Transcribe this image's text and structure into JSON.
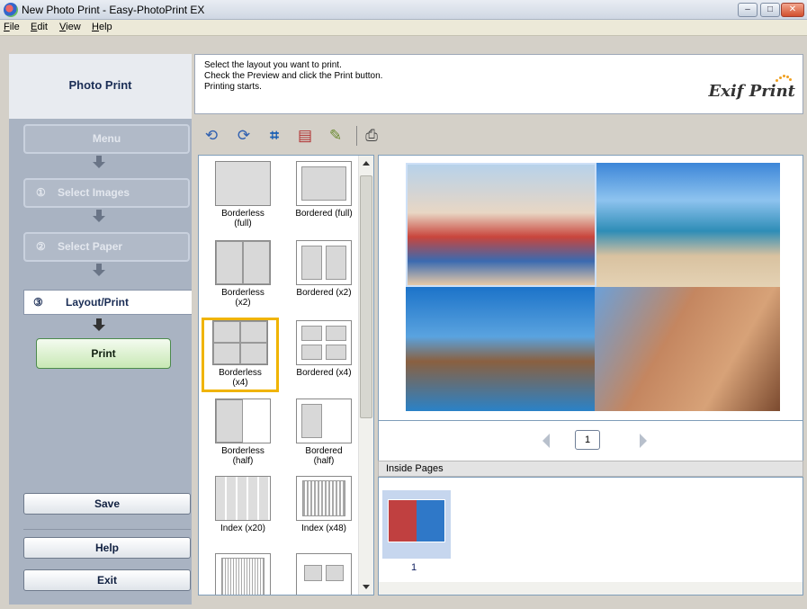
{
  "window": {
    "title": "New Photo Print - Easy-PhotoPrint EX"
  },
  "menu": [
    {
      "underline": "F",
      "rest": "ile"
    },
    {
      "underline": "E",
      "rest": "dit"
    },
    {
      "underline": "V",
      "rest": "iew"
    },
    {
      "underline": "H",
      "rest": "elp"
    }
  ],
  "left": {
    "header": "Photo Print",
    "menu_label": "Menu",
    "steps": [
      {
        "num": "①",
        "label": "Select Images"
      },
      {
        "num": "②",
        "label": "Select Paper"
      }
    ],
    "active": {
      "num": "③",
      "label": "Layout/Print"
    },
    "print_label": "Print",
    "save_label": "Save",
    "help_label": "Help",
    "exit_label": "Exit"
  },
  "instructions": {
    "lines": [
      "Select the layout you want to print.",
      "Check the Preview and click the Print button.",
      "Printing starts."
    ],
    "logo": "Exif Print"
  },
  "toolbar": {
    "icons": [
      "rotate-left-icon",
      "rotate-right-icon",
      "crop-icon",
      "image-correct-icon",
      "color-adjust-icon",
      "print-settings-icon"
    ]
  },
  "layouts": [
    {
      "line1": "Borderless",
      "line2": "(full)"
    },
    {
      "line1": "Bordered (full)",
      "line2": ""
    },
    {
      "line1": "Borderless",
      "line2": "(x2)"
    },
    {
      "line1": "Bordered (x2)",
      "line2": ""
    },
    {
      "line1": "Borderless",
      "line2": "(x4)"
    },
    {
      "line1": "Bordered (x4)",
      "line2": ""
    },
    {
      "line1": "Borderless",
      "line2": "(half)"
    },
    {
      "line1": "Bordered",
      "line2": "(half)"
    },
    {
      "line1": "Index (x20)",
      "line2": ""
    },
    {
      "line1": "Index (x48)",
      "line2": ""
    }
  ],
  "selected_layout": "Borderless (x4)",
  "preview": {
    "page": "1"
  },
  "inside_pages": {
    "header": "Inside Pages",
    "thumb_number": "1"
  },
  "colors": {
    "left_panel": "#a9b3c2",
    "selection": "#f0b400",
    "print_button": "#c8e8b4"
  }
}
